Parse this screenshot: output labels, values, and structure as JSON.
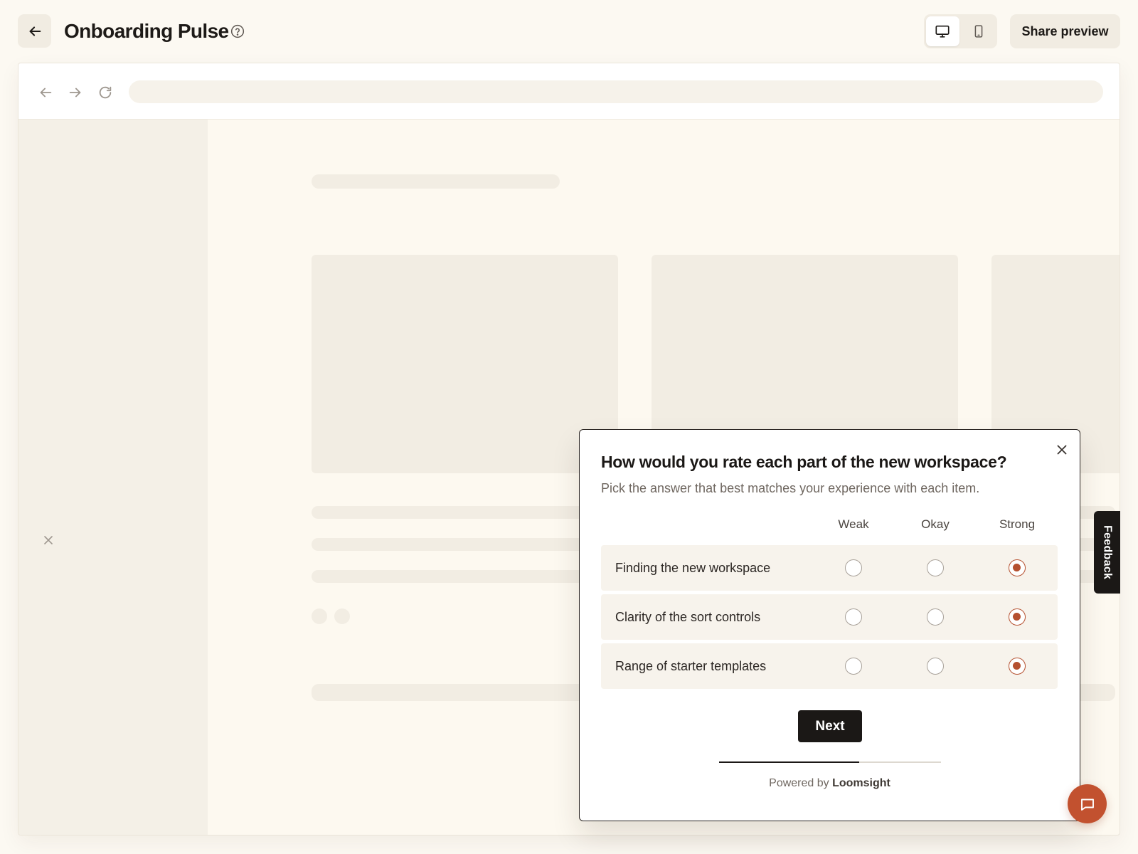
{
  "header": {
    "title": "Onboarding Pulse",
    "share_label": "Share preview",
    "view_modes": [
      "desktop",
      "mobile"
    ],
    "active_view": "desktop"
  },
  "icons": {
    "back": "arrow-left-icon",
    "help": "question-circle-icon",
    "desktop": "monitor-icon",
    "mobile": "phone-icon",
    "browser_back": "arrow-left-icon",
    "browser_forward": "arrow-right-icon",
    "reload": "reload-icon",
    "close": "close-icon",
    "chat": "chat-bubble-icon"
  },
  "survey": {
    "question": "How would you rate each part of the new workspace?",
    "hint": "Pick the answer that best matches your experience with each item.",
    "columns": [
      "Weak",
      "Okay",
      "Strong"
    ],
    "rows": [
      {
        "label": "Finding the new workspace",
        "selected": "Strong"
      },
      {
        "label": "Clarity of the sort controls",
        "selected": "Strong"
      },
      {
        "label": "Range of starter templates",
        "selected": "Strong"
      }
    ],
    "next_label": "Next",
    "progress": 0.63,
    "powered_prefix": "Powered by",
    "powered_brand": "Loomsight"
  },
  "feedback_tab_label": "Feedback",
  "colors": {
    "accent": "#b5502f",
    "chat_button": "#c2512f",
    "dark": "#1b1816",
    "background": "#fcf9f2"
  }
}
